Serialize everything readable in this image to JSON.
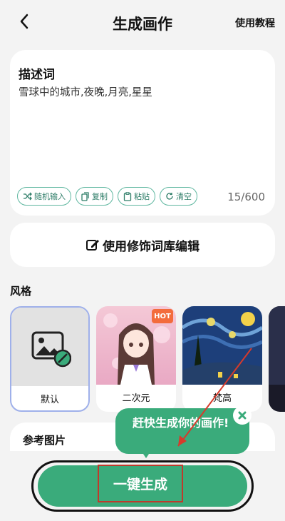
{
  "header": {
    "title": "生成画作",
    "tutorial_label": "使用教程"
  },
  "description": {
    "label": "描述词",
    "text": "雪球中的城市,夜晚,月亮,星星",
    "actions": [
      {
        "label": "随机输入",
        "icon": "shuffle-icon"
      },
      {
        "label": "复制",
        "icon": "copy-icon"
      },
      {
        "label": "粘贴",
        "icon": "paste-icon"
      },
      {
        "label": "清空",
        "icon": "refresh-icon"
      }
    ],
    "counter": "15/600"
  },
  "modifier": {
    "label": "使用修饰词库编辑",
    "icon": "edit-icon"
  },
  "styles": {
    "label": "风格",
    "items": [
      {
        "name": "默认",
        "selected": true
      },
      {
        "name": "二次元",
        "badge": "HOT"
      },
      {
        "name": "梵高"
      }
    ]
  },
  "reference": {
    "label": "参考图片"
  },
  "tooltip": {
    "text": "赶快生成你的画作!"
  },
  "generate": {
    "label": "一键生成"
  },
  "colors": {
    "accent": "#3aab7b",
    "highlight": "#c0392b"
  }
}
